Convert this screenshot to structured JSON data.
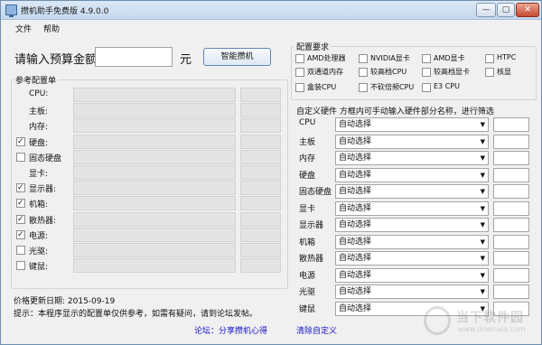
{
  "window": {
    "title": "攒机助手免费版 4.9.0.0",
    "min_label": "—",
    "max_label": "▢",
    "close_label": "✕"
  },
  "menu": [
    "文件",
    "帮助"
  ],
  "budget": {
    "label": "请输入预算金额",
    "value": "",
    "unit": "元",
    "smart_button": "智能攒机"
  },
  "reference": {
    "title": "参考配置单",
    "rows": [
      {
        "label": "CPU:",
        "checkbox": false,
        "checked": false
      },
      {
        "label": "主板:",
        "checkbox": false,
        "checked": false
      },
      {
        "label": "内存:",
        "checkbox": false,
        "checked": false
      },
      {
        "label": "硬盘:",
        "checkbox": true,
        "checked": true
      },
      {
        "label": "固态硬盘",
        "checkbox": true,
        "checked": false
      },
      {
        "label": "显卡:",
        "checkbox": false,
        "checked": false
      },
      {
        "label": "显示器:",
        "checkbox": true,
        "checked": true
      },
      {
        "label": "机箱:",
        "checkbox": true,
        "checked": true
      },
      {
        "label": "散热器:",
        "checkbox": true,
        "checked": true
      },
      {
        "label": "电源:",
        "checkbox": true,
        "checked": true
      },
      {
        "label": "光驱:",
        "checkbox": true,
        "checked": false
      },
      {
        "label": "键鼠:",
        "checkbox": true,
        "checked": false
      }
    ]
  },
  "requirements": {
    "title": "配置要求",
    "items": [
      {
        "label": "AMD处理器",
        "checked": false
      },
      {
        "label": "NVIDIA显卡",
        "checked": false
      },
      {
        "label": "AMD显卡",
        "checked": false
      },
      {
        "label": "HTPC",
        "checked": false
      },
      {
        "label": "双通道内存",
        "checked": false
      },
      {
        "label": "较高档CPU",
        "checked": false
      },
      {
        "label": "较高档显卡",
        "checked": false
      },
      {
        "label": "核显",
        "checked": false
      },
      {
        "label": "盒装CPU",
        "checked": false
      },
      {
        "label": "不砍倍频CPU",
        "checked": false
      },
      {
        "label": "E3 CPU",
        "checked": false
      }
    ]
  },
  "custom": {
    "title": "自定义硬件 方框内可手动输入硬件部分名称，进行筛选",
    "rows": [
      {
        "label": "CPU",
        "value": "自动选择"
      },
      {
        "label": "主板",
        "value": "自动选择"
      },
      {
        "label": "内存",
        "value": "自动选择"
      },
      {
        "label": "硬盘",
        "value": "自动选择"
      },
      {
        "label": "固态硬盘",
        "value": "自动选择"
      },
      {
        "label": "显卡",
        "value": "自动选择"
      },
      {
        "label": "显示器",
        "value": "自动选择"
      },
      {
        "label": "机箱",
        "value": "自动选择"
      },
      {
        "label": "散热器",
        "value": "自动选择"
      },
      {
        "label": "电源",
        "value": "自动选择"
      },
      {
        "label": "光驱",
        "value": "自动选择"
      },
      {
        "label": "键鼠",
        "value": "自动选择"
      }
    ],
    "clear_link": "清除自定义"
  },
  "footer": {
    "price_update": "价格更新日期: 2015-09-19",
    "tip": "提示：本程序显示的配置单仅供参考，如需有疑问，请到论坛发帖。",
    "forum_link": "论坛：分享攒机心得"
  },
  "watermark": {
    "text1": "当下软件园",
    "text2": "www.downxia.com"
  }
}
